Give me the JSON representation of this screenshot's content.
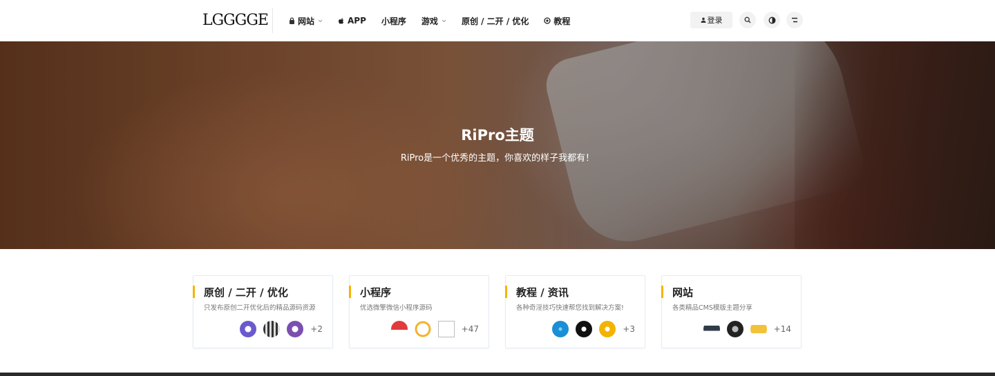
{
  "header": {
    "logo": "LGGGGE",
    "nav": [
      {
        "label": "网站",
        "icon": "lock-icon",
        "dropdown": true
      },
      {
        "label": "APP",
        "icon": "apple-icon",
        "dropdown": false
      },
      {
        "label": "小程序",
        "icon": "",
        "dropdown": false
      },
      {
        "label": "游戏",
        "icon": "",
        "dropdown": true
      },
      {
        "label": "原创 / 二开 / 优化",
        "icon": "",
        "dropdown": false
      },
      {
        "label": "教程",
        "icon": "circle-dot-icon",
        "dropdown": false
      }
    ],
    "login_label": "登录"
  },
  "hero": {
    "title": "RiPro主题",
    "subtitle": "RiPro是一个优秀的主题，你喜欢的样子我都有！"
  },
  "cards": [
    {
      "title": "原创 / 二开 / 优化",
      "desc": "只发布原创二开优化后的精品源码资源",
      "more": "+2",
      "thumbs": [
        "#6a5acd",
        "#444444",
        "#7b4fb0"
      ]
    },
    {
      "title": "小程序",
      "desc": "优选微擎微信小程序源码",
      "more": "+47",
      "thumbs": [
        "#e23b3b",
        "#f3b12a",
        "#ffffff"
      ]
    },
    {
      "title": "教程 / 资讯",
      "desc": "各种奇淫技巧快速帮您找到解决方案!",
      "more": "+3",
      "thumbs": [
        "#1a8fd6",
        "#111111",
        "#f2b400"
      ]
    },
    {
      "title": "网站",
      "desc": "各类精品CMS模版主题分享",
      "more": "+14",
      "thumbs": [
        "#2f3b4a",
        "#222222",
        "#f2c23a"
      ]
    }
  ],
  "colors": {
    "accent": "#f5b400",
    "border": "#e3ecf5"
  }
}
